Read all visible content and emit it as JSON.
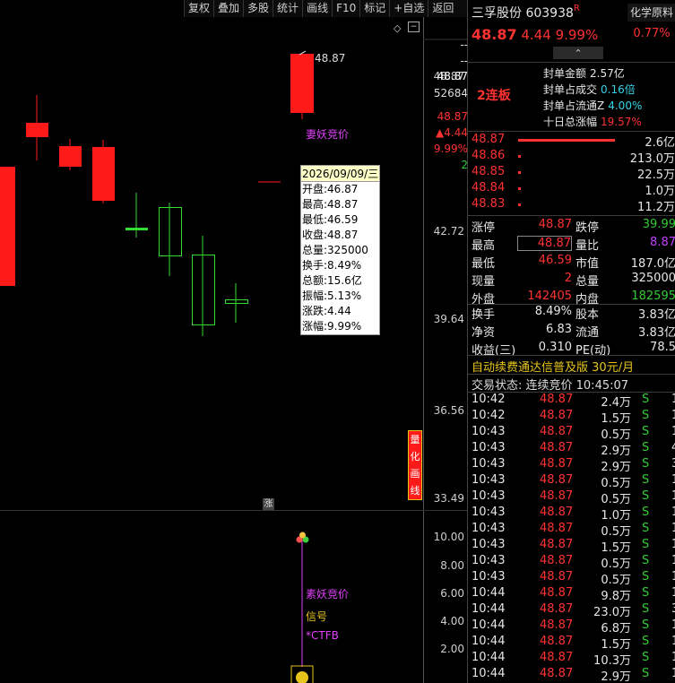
{
  "toolbar": [
    "复权",
    "叠加",
    "多股",
    "统计",
    "画线",
    "F10",
    "标记",
    "+自选",
    "返回"
  ],
  "chart": {
    "price_labels": [
      "48.87",
      "42.72",
      "39.64",
      "36.56",
      "33.49"
    ],
    "right_tags": [
      "--",
      "--",
      "48.87",
      "52684",
      "48.87",
      "▲4.44",
      "9.99%",
      "2"
    ],
    "last_price_marker": "48.87",
    "annotation_red": "妻妖竞价",
    "zhang_tag": "涨",
    "quant_btn": [
      "量",
      "化",
      "画",
      "线"
    ],
    "tooltip": {
      "date": "2026/09/09/三",
      "lines": [
        "开盘:46.87",
        "最高:48.87",
        "最低:46.59",
        "收盘:48.87",
        "总量:325000",
        "换手:8.49%",
        "总额:15.6亿",
        "振幅:5.13%",
        "涨跌:4.44",
        "涨幅:9.99%"
      ]
    },
    "indicator_labels": [
      "10.00",
      "8.00",
      "6.00",
      "4.00",
      "2.00"
    ],
    "signal_texts": [
      "素妖竞价",
      "信号",
      "*CTFB"
    ]
  },
  "quote": {
    "name": "三孚股份",
    "code": "603938",
    "flag": "R",
    "sector": "化学原料",
    "sector_pct": "0.77%",
    "price": "48.87",
    "change": "4.44",
    "pct": "9.99%",
    "arrow": "⌃",
    "streak": "2连板",
    "seal": [
      [
        "封单金额",
        "2.57亿"
      ],
      [
        "封单占成交",
        "0.16倍"
      ],
      [
        "封单占流通Z",
        "4.00%"
      ],
      [
        "十日总涨幅",
        "19.57%"
      ]
    ],
    "bids": [
      [
        "48.87",
        "2.6亿"
      ],
      [
        "48.86",
        "213.0万"
      ],
      [
        "48.85",
        "22.5万"
      ],
      [
        "48.84",
        "1.0万"
      ],
      [
        "48.83",
        "11.2万"
      ]
    ],
    "stats1": [
      [
        "涨停",
        "48.87",
        "跌停",
        "39.99"
      ],
      [
        "最高",
        "48.87",
        "量比",
        "8.87"
      ],
      [
        "最低",
        "46.59",
        "市值",
        "187.0亿"
      ],
      [
        "现量",
        "2",
        "总量",
        "325000"
      ],
      [
        "外盘",
        "142405",
        "内盘",
        "182595"
      ]
    ],
    "stats2": [
      [
        "换手",
        "8.49%",
        "股本",
        "3.83亿"
      ],
      [
        "净资",
        "6.83",
        "流通",
        "3.83亿"
      ],
      [
        "收益(三)",
        "0.310",
        "PE(动)",
        "78.5"
      ]
    ],
    "promo": "自动续费通达信普及版",
    "promo_price": "30元/月",
    "status": "交易状态: 连续竞价 10:45:07",
    "ticks": [
      [
        "10:42",
        "48.87",
        "2.4万",
        "S"
      ],
      [
        "10:42",
        "48.87",
        "1.5万",
        "S"
      ],
      [
        "10:43",
        "48.87",
        "0.5万",
        "S"
      ],
      [
        "10:43",
        "48.87",
        "2.9万",
        "S"
      ],
      [
        "10:43",
        "48.87",
        "2.9万",
        "S"
      ],
      [
        "10:43",
        "48.87",
        "0.5万",
        "S"
      ],
      [
        "10:43",
        "48.87",
        "0.5万",
        "S"
      ],
      [
        "10:43",
        "48.87",
        "1.0万",
        "S"
      ],
      [
        "10:43",
        "48.87",
        "0.5万",
        "S"
      ],
      [
        "10:43",
        "48.87",
        "1.5万",
        "S"
      ],
      [
        "10:43",
        "48.87",
        "0.5万",
        "S"
      ],
      [
        "10:43",
        "48.87",
        "0.5万",
        "S"
      ],
      [
        "10:44",
        "48.87",
        "9.8万",
        "S"
      ],
      [
        "10:44",
        "48.87",
        "23.0万",
        "S"
      ],
      [
        "10:44",
        "48.87",
        "6.8万",
        "S"
      ],
      [
        "10:44",
        "48.87",
        "1.5万",
        "S"
      ],
      [
        "10:44",
        "48.87",
        "10.3万",
        "S"
      ],
      [
        "10:44",
        "48.87",
        "2.9万",
        "S"
      ]
    ],
    "tick_tail": [
      "1",
      "1",
      "1",
      "4",
      "3",
      "1",
      "1",
      "1",
      "1",
      "1",
      "1",
      "1",
      "1",
      "3",
      "1",
      "1",
      "1",
      "1"
    ]
  }
}
